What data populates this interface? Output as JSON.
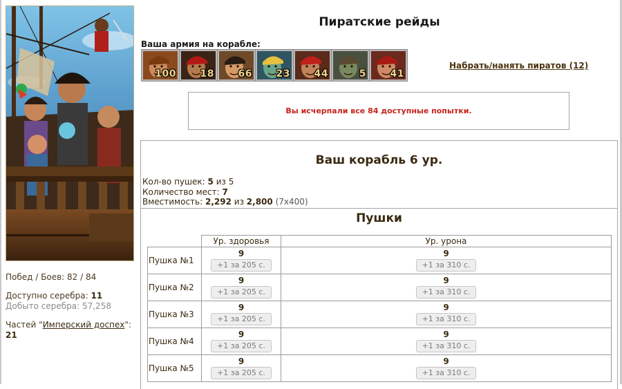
{
  "title": "Пиратские рейды",
  "army": {
    "label": "Ваша армия на корабле:",
    "units": [
      {
        "icon": "pirate-brown-bandana-icon",
        "count": "100",
        "bg": "#8b4a1e",
        "skin": "#c9895a",
        "hat": "#7a3a10"
      },
      {
        "icon": "pirate-red-bandana-icon",
        "count": "18",
        "bg": "#3a2418",
        "skin": "#b47a4e",
        "hat": "#b31a16"
      },
      {
        "icon": "pirate-captain-icon",
        "count": "66",
        "bg": "#6e4a2a",
        "skin": "#d69a68",
        "hat": "#2a1c12"
      },
      {
        "icon": "lizard-pirate-icon",
        "count": "23",
        "bg": "#2f5560",
        "skin": "#6aa58a",
        "hat": "#e8c040"
      },
      {
        "icon": "pirate-red-hat-icon",
        "count": "44",
        "bg": "#5a2a1a",
        "skin": "#c2825a",
        "hat": "#c0201a"
      },
      {
        "icon": "goblin-pirate-icon",
        "count": "5",
        "bg": "#4a5040",
        "skin": "#7a8a60",
        "hat": "#5a4a30"
      },
      {
        "icon": "pirate-woman-icon",
        "count": "41",
        "bg": "#6a2a1e",
        "skin": "#cf8a66",
        "hat": "#a81a14"
      }
    ]
  },
  "hire_link": "Набрать/нанять пиратов (12)",
  "alert": "Вы исчерпали все 84 доступные попытки.",
  "sidebar": {
    "wins_label": "Побед / Боев:",
    "wins_value": "82 / 84",
    "silver_label": "Доступно серебра:",
    "silver_value": "11",
    "mined_label": "Добыто серебра:",
    "mined_value": "57,258",
    "parts_prefix": "Частей \"",
    "parts_link": "Имперский доспех",
    "parts_suffix": "\":",
    "parts_value": "21"
  },
  "ship": {
    "title": "Ваш корабль 6 ур.",
    "cannons_label": "Кол-во пушек:",
    "cannons_value": "5",
    "cannons_of": "из 5",
    "seats_label": "Количество мест:",
    "seats_value": "7",
    "capacity_label": "Вместимость:",
    "capacity_value": "2,292",
    "capacity_of": "из",
    "capacity_max": "2,800",
    "capacity_extra": "(7x400)"
  },
  "guns": {
    "title": "Пушки",
    "col_health": "Ур. здоровья",
    "col_damage": "Ур. урона",
    "rows": [
      {
        "name": "Пушка №1",
        "health": "9",
        "health_btn": "+1 за 205 с.",
        "damage": "9",
        "damage_btn": "+1 за 310 с."
      },
      {
        "name": "Пушка №2",
        "health": "9",
        "health_btn": "+1 за 205 с.",
        "damage": "9",
        "damage_btn": "+1 за 310 с."
      },
      {
        "name": "Пушка №3",
        "health": "9",
        "health_btn": "+1 за 205 с.",
        "damage": "9",
        "damage_btn": "+1 за 310 с."
      },
      {
        "name": "Пушка №4",
        "health": "9",
        "health_btn": "+1 за 205 с.",
        "damage": "9",
        "damage_btn": "+1 за 310 с."
      },
      {
        "name": "Пушка №5",
        "health": "9",
        "health_btn": "+1 за 205 с.",
        "damage": "9",
        "damage_btn": "+1 за 310 с."
      }
    ]
  }
}
